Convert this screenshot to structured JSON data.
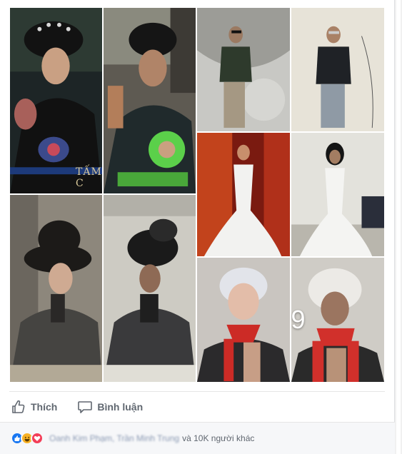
{
  "post": {
    "photos": [
      {
        "id": "p1",
        "subject": "woman-in-ao-dai-headdress-with-fan",
        "caption": "TẤM C"
      },
      {
        "id": "p2",
        "subject": "man-in-costume-with-green-flower"
      },
      {
        "id": "p3",
        "subject": "man-in-jacket-sunglasses-studio"
      },
      {
        "id": "p4",
        "subject": "man-in-jacket-sunglasses-room"
      },
      {
        "id": "p5",
        "subject": "woman-in-white-mermaid-gown"
      },
      {
        "id": "p6",
        "subject": "man-in-white-gown"
      },
      {
        "id": "p7",
        "subject": "woman-in-fur-hat-and-coat"
      },
      {
        "id": "p8",
        "subject": "man-in-fur-hat-and-coat"
      },
      {
        "id": "p9",
        "subject": "man-silver-hair-red-scarf"
      },
      {
        "id": "p10",
        "subject": "man-white-wig-red-scarf"
      }
    ],
    "more_count": "+9"
  },
  "actions": {
    "like_label": "Thích",
    "comment_label": "Bình luận"
  },
  "reactions": {
    "icons": [
      "like-reaction-icon",
      "haha-reaction-icon",
      "love-reaction-icon"
    ],
    "names": "Oanh Kim Phạm, Trần Minh Trung",
    "others": "và 10K người khác"
  },
  "colors": {
    "like": "#1877f2",
    "haha": "#f7b125",
    "love": "#f33e58",
    "action_text": "#606770"
  }
}
